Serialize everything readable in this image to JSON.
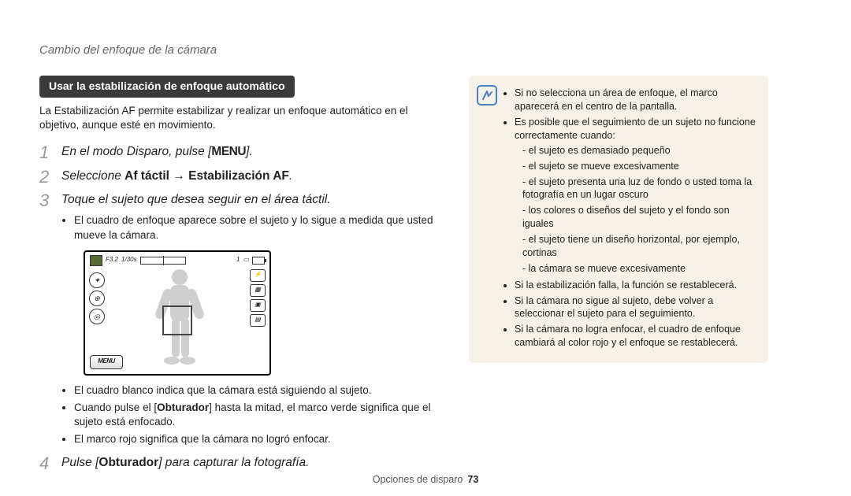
{
  "header": "Cambio del enfoque de la cámara",
  "heading": "Usar la estabilización de enfoque automático",
  "intro": "La Estabilización AF permite estabilizar y realizar un enfoque automático en el objetivo, aunque esté en movimiento.",
  "steps": {
    "s1_pre": "En el modo Disparo, pulse [",
    "s1_key": "MENU",
    "s1_post": "].",
    "s2_pre": "Seleccione ",
    "s2_b1": "Af táctil",
    "s2_arrow": " → ",
    "s2_b2": "Estabilización AF",
    "s2_post": ".",
    "s3": "Toque el sujeto que desea seguir en el área táctil.",
    "s3_sub1": "El cuadro de enfoque aparece sobre el sujeto y lo sigue a medida que usted mueve la cámara.",
    "s3_sub2": "El cuadro blanco indica que la cámara está siguiendo al sujeto.",
    "s3_sub3_pre": "Cuando pulse el [",
    "s3_sub3_b": "Obturador",
    "s3_sub3_post": "] hasta la mitad, el marco verde significa que el sujeto está enfocado.",
    "s3_sub4": "El marco rojo significa que la cámara no logró enfocar.",
    "s4_pre": "Pulse [",
    "s4_b": "Obturador",
    "s4_post": "] para capturar la fotografía."
  },
  "camera": {
    "fstop": "F3.2",
    "shutter": "1/30s",
    "count": "1",
    "menu": "MENU"
  },
  "notes": {
    "n1": "Si no selecciona un área de enfoque, el marco aparecerá en el centro de la pantalla.",
    "n2": "Es posible que el seguimiento de un sujeto no funcione correctamente cuando:",
    "n2a": "el sujeto es demasiado pequeño",
    "n2b": "el sujeto se mueve excesivamente",
    "n2c": "el sujeto presenta una luz de fondo o usted toma la fotografía en un lugar oscuro",
    "n2d": "los colores o diseños del sujeto y el fondo son iguales",
    "n2e": "el sujeto tiene un diseño horizontal, por ejemplo, cortinas",
    "n2f": "la cámara se mueve excesivamente",
    "n3": "Si la estabilización falla, la función se restablecerá.",
    "n4": "Si la cámara no sigue al sujeto, debe volver a seleccionar el sujeto para el seguimiento.",
    "n5": "Si la cámara no logra enfocar, el cuadro de enfoque cambiará al color rojo y el enfoque se restablecerá."
  },
  "footer": {
    "section": "Opciones de disparo",
    "page": "73"
  }
}
